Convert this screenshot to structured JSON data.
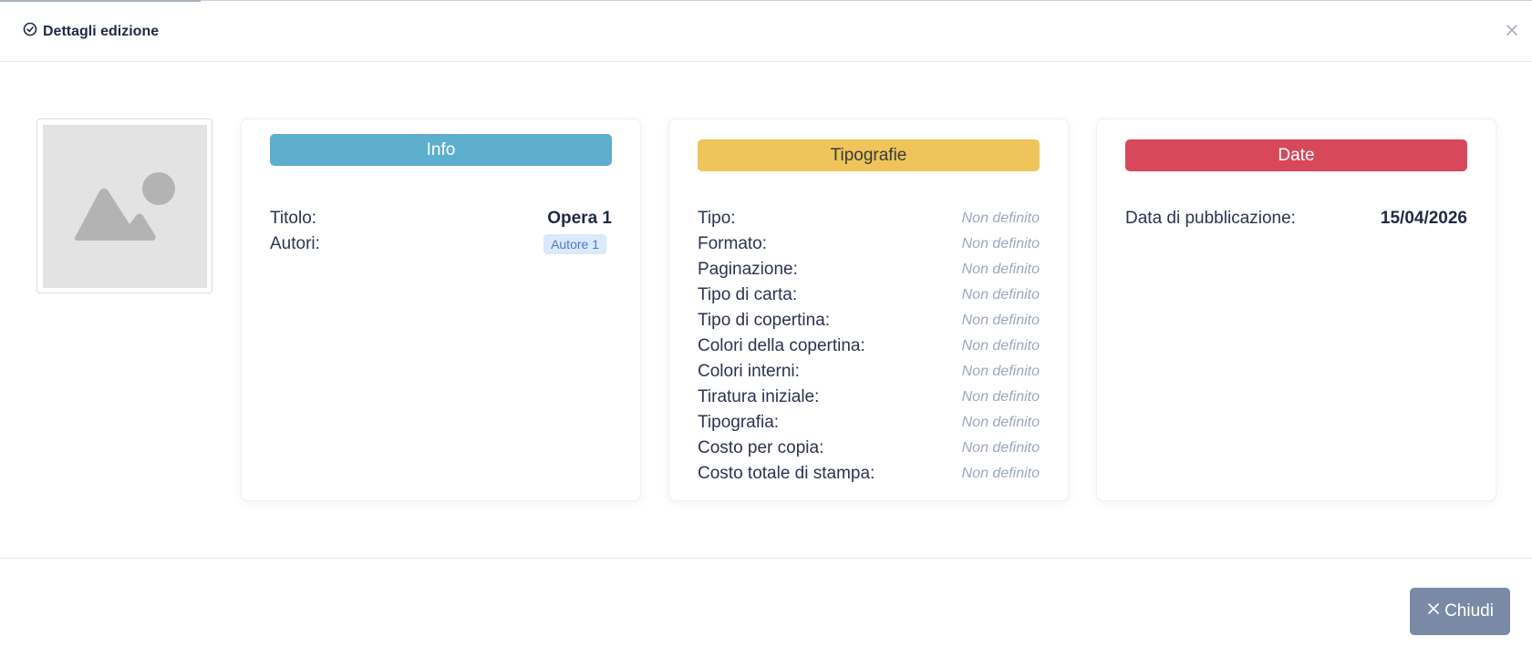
{
  "modal": {
    "title": "Dettagli edizione"
  },
  "info": {
    "header": "Info",
    "rows": [
      {
        "label": "Titolo:",
        "value": "Opera 1"
      },
      {
        "label": "Autori:",
        "badge": "Autore 1"
      }
    ]
  },
  "tipografie": {
    "header": "Tipografie",
    "rows": [
      {
        "label": "Tipo:",
        "value": "Non definito"
      },
      {
        "label": "Formato:",
        "value": "Non definito"
      },
      {
        "label": "Paginazione:",
        "value": "Non definito"
      },
      {
        "label": "Tipo di carta:",
        "value": "Non definito"
      },
      {
        "label": "Tipo di copertina:",
        "value": "Non definito"
      },
      {
        "label": "Colori della copertina:",
        "value": "Non definito"
      },
      {
        "label": "Colori interni:",
        "value": "Non definito"
      },
      {
        "label": "Tiratura iniziale:",
        "value": "Non definito"
      },
      {
        "label": "Tipografia:",
        "value": "Non definito"
      },
      {
        "label": "Costo per copia:",
        "value": "Non definito"
      },
      {
        "label": "Costo totale di stampa:",
        "value": "Non definito"
      }
    ]
  },
  "date": {
    "header": "Date",
    "rows": [
      {
        "label": "Data di pubblicazione:",
        "value": "15/04/2026"
      }
    ]
  },
  "footer": {
    "close_label": "Chiudi"
  },
  "colors": {
    "info": "#5eaecd",
    "tipografie": "#eec45b",
    "date": "#d7485a",
    "close_button": "#7a89a6"
  },
  "icons": {
    "title": "circle-check-icon",
    "close": "close-icon",
    "image_placeholder": "image-placeholder-icon",
    "button": "x-icon"
  }
}
